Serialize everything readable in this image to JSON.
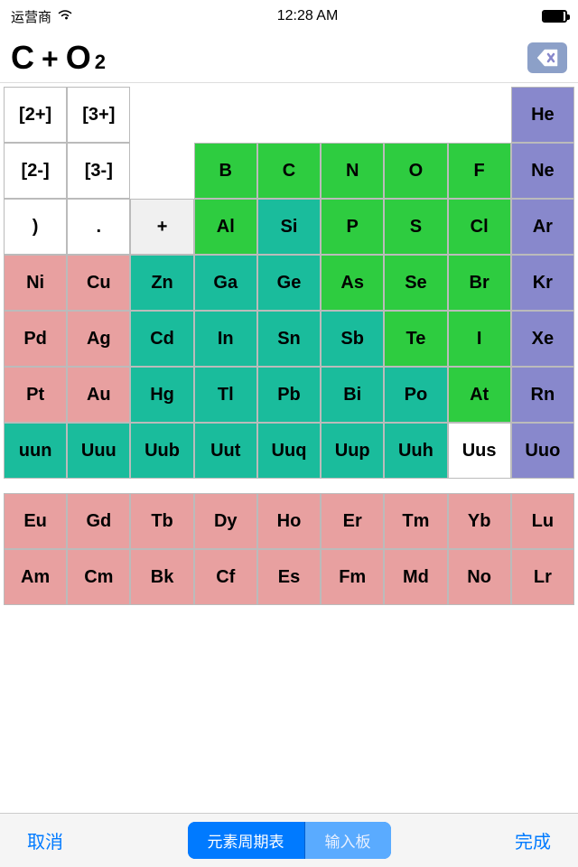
{
  "status": {
    "carrier": "运营商",
    "time": "12:28 AM",
    "battery": 90
  },
  "formula": {
    "display": "C + O₂",
    "parts": [
      "C",
      "+",
      "O",
      "2"
    ]
  },
  "backspace_label": "⌫",
  "toolbar": {
    "cancel": "取消",
    "periodic_table": "元素周期表",
    "input_panel": "输入板",
    "done": "完成"
  },
  "rows": [
    {
      "id": "row0",
      "cells": [
        {
          "label": "[2+]",
          "type": "white"
        },
        {
          "label": "[3+]",
          "type": "white"
        },
        {
          "label": "",
          "type": "empty"
        },
        {
          "label": "",
          "type": "empty"
        },
        {
          "label": "",
          "type": "empty"
        },
        {
          "label": "",
          "type": "empty"
        },
        {
          "label": "",
          "type": "empty"
        },
        {
          "label": "",
          "type": "empty"
        },
        {
          "label": "He",
          "type": "blue-purple"
        }
      ]
    },
    {
      "id": "row1",
      "cells": [
        {
          "label": "[2-]",
          "type": "white"
        },
        {
          "label": "[3-]",
          "type": "white"
        },
        {
          "label": "",
          "type": "empty"
        },
        {
          "label": "B",
          "type": "green"
        },
        {
          "label": "C",
          "type": "green"
        },
        {
          "label": "N",
          "type": "green"
        },
        {
          "label": "O",
          "type": "green"
        },
        {
          "label": "F",
          "type": "green"
        },
        {
          "label": "Ne",
          "type": "blue-purple"
        }
      ]
    },
    {
      "id": "row2",
      "cells": [
        {
          "label": ")",
          "type": "white"
        },
        {
          "label": ".",
          "type": "white"
        },
        {
          "label": "+",
          "type": "operator"
        },
        {
          "label": "Al",
          "type": "green"
        },
        {
          "label": "Si",
          "type": "teal"
        },
        {
          "label": "P",
          "type": "green"
        },
        {
          "label": "S",
          "type": "green"
        },
        {
          "label": "Cl",
          "type": "green"
        },
        {
          "label": "Ar",
          "type": "blue-purple"
        }
      ]
    },
    {
      "id": "row3",
      "cells": [
        {
          "label": "Ni",
          "type": "pink"
        },
        {
          "label": "Cu",
          "type": "pink"
        },
        {
          "label": "Zn",
          "type": "teal"
        },
        {
          "label": "Ga",
          "type": "teal"
        },
        {
          "label": "Ge",
          "type": "teal"
        },
        {
          "label": "As",
          "type": "green"
        },
        {
          "label": "Se",
          "type": "green"
        },
        {
          "label": "Br",
          "type": "green"
        },
        {
          "label": "Kr",
          "type": "blue-purple"
        }
      ]
    },
    {
      "id": "row4",
      "cells": [
        {
          "label": "Pd",
          "type": "pink"
        },
        {
          "label": "Ag",
          "type": "pink"
        },
        {
          "label": "Cd",
          "type": "teal"
        },
        {
          "label": "In",
          "type": "teal"
        },
        {
          "label": "Sn",
          "type": "teal"
        },
        {
          "label": "Sb",
          "type": "teal"
        },
        {
          "label": "Te",
          "type": "green"
        },
        {
          "label": "I",
          "type": "green"
        },
        {
          "label": "Xe",
          "type": "blue-purple"
        }
      ]
    },
    {
      "id": "row5",
      "cells": [
        {
          "label": "Pt",
          "type": "pink"
        },
        {
          "label": "Au",
          "type": "pink"
        },
        {
          "label": "Hg",
          "type": "teal"
        },
        {
          "label": "Tl",
          "type": "teal"
        },
        {
          "label": "Pb",
          "type": "teal"
        },
        {
          "label": "Bi",
          "type": "teal"
        },
        {
          "label": "Po",
          "type": "teal"
        },
        {
          "label": "At",
          "type": "green"
        },
        {
          "label": "Rn",
          "type": "blue-purple"
        }
      ]
    },
    {
      "id": "row6",
      "cells": [
        {
          "label": "uun",
          "type": "teal"
        },
        {
          "label": "Uuu",
          "type": "teal"
        },
        {
          "label": "Uub",
          "type": "teal"
        },
        {
          "label": "Uut",
          "type": "teal"
        },
        {
          "label": "Uuq",
          "type": "teal"
        },
        {
          "label": "Uup",
          "type": "teal"
        },
        {
          "label": "Uuh",
          "type": "teal"
        },
        {
          "label": "Uus",
          "type": "white"
        },
        {
          "label": "Uuo",
          "type": "blue-purple"
        }
      ]
    }
  ],
  "lanthanides": [
    {
      "label": "Eu",
      "type": "pink"
    },
    {
      "label": "Gd",
      "type": "pink"
    },
    {
      "label": "Tb",
      "type": "pink"
    },
    {
      "label": "Dy",
      "type": "pink"
    },
    {
      "label": "Ho",
      "type": "pink"
    },
    {
      "label": "Er",
      "type": "pink"
    },
    {
      "label": "Tm",
      "type": "pink"
    },
    {
      "label": "Yb",
      "type": "pink"
    },
    {
      "label": "Lu",
      "type": "pink"
    }
  ],
  "actinides": [
    {
      "label": "Am",
      "type": "pink"
    },
    {
      "label": "Cm",
      "type": "pink"
    },
    {
      "label": "Bk",
      "type": "pink"
    },
    {
      "label": "Cf",
      "type": "pink"
    },
    {
      "label": "Es",
      "type": "pink"
    },
    {
      "label": "Fm",
      "type": "pink"
    },
    {
      "label": "Md",
      "type": "pink"
    },
    {
      "label": "No",
      "type": "pink"
    },
    {
      "label": "Lr",
      "type": "pink"
    }
  ]
}
